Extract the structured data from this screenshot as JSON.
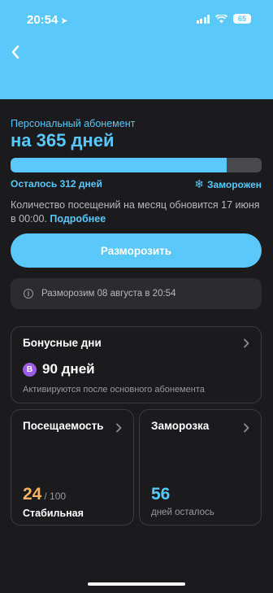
{
  "status_bar": {
    "time": "20:54",
    "battery": "65"
  },
  "subscription": {
    "label": "Персональный абонемент",
    "title": "на 365 дней",
    "progress": 0.86,
    "remaining": "Осталось 312 дней",
    "status": "Заморожен",
    "info": "Количество посещений на месяц обновится 17 июня в 00:00.",
    "more_link": "Подробнее"
  },
  "unfreeze_button": "Разморозить",
  "notice": "Разморозим 08 августа в 20:54",
  "bonus": {
    "title": "Бонусные дни",
    "badge": "B",
    "days": "90 дней",
    "subtitle": "Активируются после основного абонемента"
  },
  "attendance": {
    "title": "Посещаемость",
    "value": "24",
    "of": "/ 100",
    "label": "Стабильная"
  },
  "freeze": {
    "title": "Заморозка",
    "value": "56",
    "label": "дней осталось"
  },
  "colors": {
    "accent": "#5ac8fa",
    "background": "#1b1b1d",
    "attendance": "#f7b267",
    "bonus_badge": "#9b5de5"
  }
}
